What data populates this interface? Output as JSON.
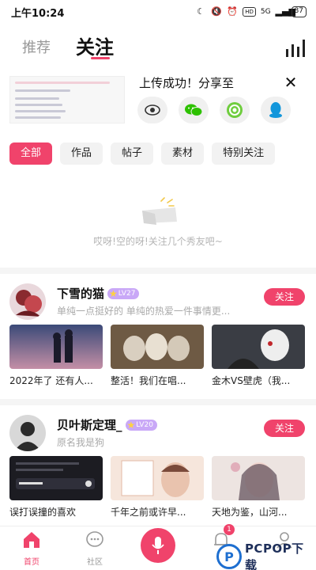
{
  "status_bar": {
    "time": "上午10:24",
    "network": "5G",
    "battery": "87"
  },
  "tabs": {
    "recommend": "推荐",
    "following": "关注"
  },
  "share": {
    "title": "上传成功！分享至",
    "targets": [
      "eye-icon",
      "wechat-icon",
      "moments-icon",
      "qq-icon"
    ]
  },
  "filters": [
    "全部",
    "作品",
    "帖子",
    "素材",
    "特别关注"
  ],
  "empty_text": "哎呀!空的呀!关注几个秀友吧~",
  "users": [
    {
      "name": "下雪的猫",
      "level": "LV27",
      "bio": "单纯一点挺好的 单纯的热爱一件事情更...",
      "follow_label": "关注",
      "works": [
        "2022年了 还有人...",
        "整活！我们在唱...",
        "金木VS壁虎（我..."
      ]
    },
    {
      "name": "贝叶斯定理_",
      "level": "LV20",
      "bio": "原名我是狗",
      "follow_label": "关注",
      "works": [
        "误打误撞的喜欢",
        "千年之前或许早...",
        "天地为鉴，山河..."
      ]
    }
  ],
  "bottom_nav": {
    "home": "首页",
    "community": "社区",
    "notify_badge": "1"
  },
  "watermark": {
    "letter": "P",
    "text": "PCPOP下载"
  },
  "colors": {
    "accent": "#f0436b",
    "level_badge": "#c9a8f7"
  }
}
